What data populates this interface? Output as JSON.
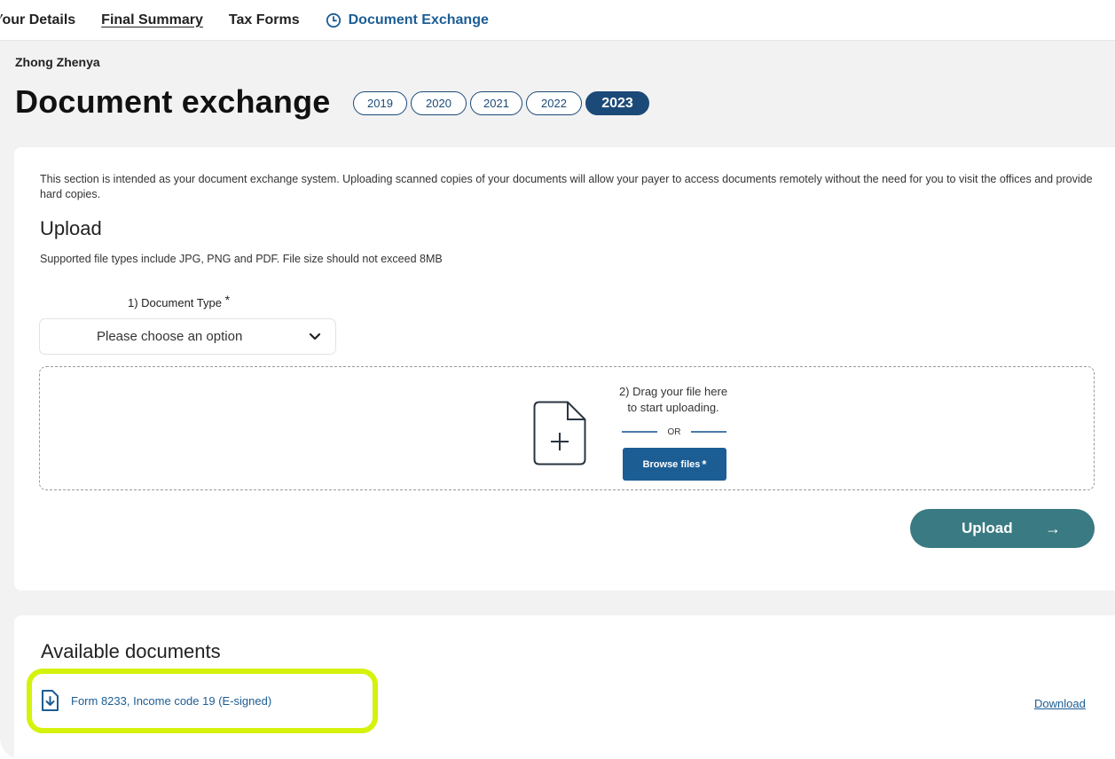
{
  "nav": {
    "items": [
      {
        "label": "Your Details",
        "style": "plain"
      },
      {
        "label": "Final Summary",
        "style": "underline"
      },
      {
        "label": "Tax Forms",
        "style": "plain"
      },
      {
        "label": "Document Exchange",
        "style": "active",
        "icon": "clock-icon"
      }
    ]
  },
  "user": {
    "name": "Zhong Zhenya"
  },
  "page": {
    "title": "Document exchange"
  },
  "years": {
    "options": [
      "2019",
      "2020",
      "2021",
      "2022",
      "2023"
    ],
    "selected": "2023"
  },
  "upload_section": {
    "intro": "This section is intended as your document exchange system. Uploading scanned copies of your documents will allow your payer to access documents remotely without the need for you to visit the offices and provide hard copies.",
    "title": "Upload",
    "supported": "Supported file types include JPG, PNG and PDF. File size should not exceed 8MB",
    "doc_type_label": "1) Document Type",
    "required_mark": "*",
    "doc_type_placeholder": "Please choose an option",
    "drag_line1": "2) Drag your file here",
    "drag_line2": "to start uploading.",
    "or_text": "OR",
    "browse_label": "Browse files",
    "upload_button": "Upload",
    "upload_arrow": "→"
  },
  "available_documents": {
    "title": "Available documents",
    "items": [
      {
        "name": "Form 8233, Income code 19 (E-signed)",
        "action": "Download",
        "highlighted": true
      }
    ]
  },
  "colors": {
    "primary_blue": "#1c5d94",
    "navy": "#1c4a78",
    "teal_button": "#3a7a82",
    "highlight": "#d4f20c",
    "background": "#f2f2f2"
  }
}
